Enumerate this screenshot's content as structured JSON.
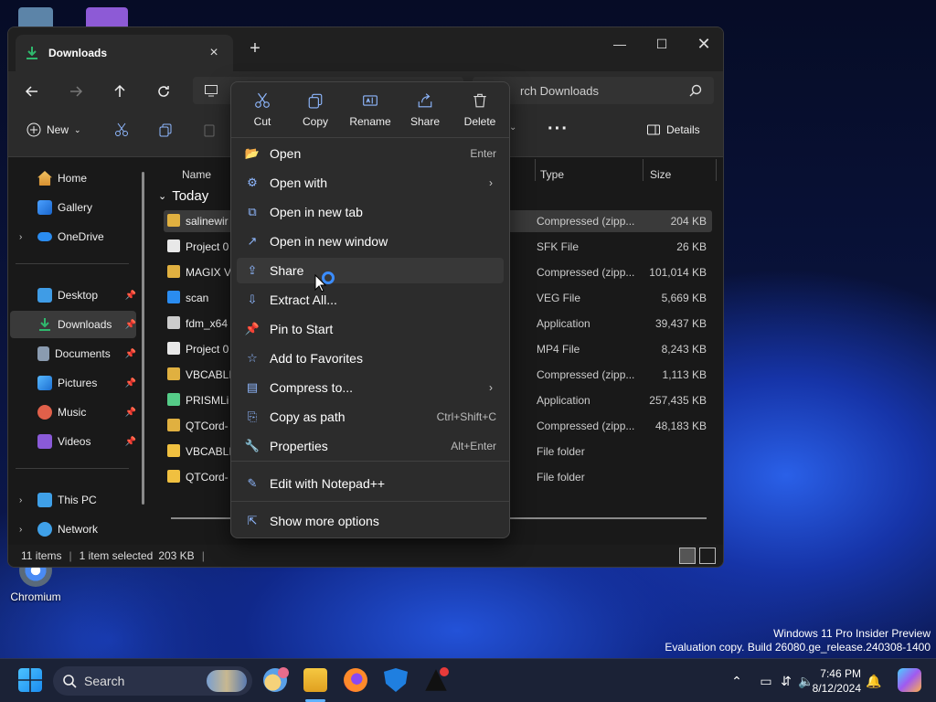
{
  "desktop": {
    "chromium_label": "Chromium",
    "watermark_line1": "Windows 11 Pro Insider Preview",
    "watermark_line2": "Evaluation copy. Build 26080.ge_release.240308-1400"
  },
  "window": {
    "tab_title": "Downloads",
    "search_placeholder": "rch Downloads",
    "toolbar": {
      "new_label": "New",
      "details_label": "Details"
    },
    "sidebar": [
      {
        "label": "Home",
        "icon": "home-icon"
      },
      {
        "label": "Gallery",
        "icon": "gallery-icon"
      },
      {
        "label": "OneDrive",
        "icon": "cloud-icon"
      },
      {
        "label": "Desktop",
        "icon": "desktop-icon"
      },
      {
        "label": "Downloads",
        "icon": "download-icon"
      },
      {
        "label": "Documents",
        "icon": "documents-icon"
      },
      {
        "label": "Pictures",
        "icon": "pictures-icon"
      },
      {
        "label": "Music",
        "icon": "music-icon"
      },
      {
        "label": "Videos",
        "icon": "videos-icon"
      },
      {
        "label": "This PC",
        "icon": "pc-icon"
      },
      {
        "label": "Network",
        "icon": "network-icon"
      }
    ],
    "columns": {
      "name": "Name",
      "type": "Type",
      "size": "Size"
    },
    "group": "Today",
    "files": [
      {
        "name": "salinewir",
        "type": "Compressed (zipp...",
        "size": "204 KB"
      },
      {
        "name": "Project 0",
        "type": "SFK File",
        "size": "26 KB"
      },
      {
        "name": "MAGIX V",
        "type": "Compressed (zipp...",
        "size": "101,014 KB"
      },
      {
        "name": "scan",
        "type": "VEG File",
        "size": "5,669 KB"
      },
      {
        "name": "fdm_x64",
        "type": "Application",
        "size": "39,437 KB"
      },
      {
        "name": "Project 0",
        "type": "MP4 File",
        "size": "8,243 KB"
      },
      {
        "name": "VBCABLI",
        "type": "Compressed (zipp...",
        "size": "1,113 KB"
      },
      {
        "name": "PRISMLi",
        "type": "Application",
        "size": "257,435 KB"
      },
      {
        "name": "QTCord-",
        "type": "Compressed (zipp...",
        "size": "48,183 KB"
      },
      {
        "name": "VBCABLI",
        "type": "File folder",
        "size": ""
      },
      {
        "name": "QTCord-",
        "type": "File folder",
        "size": ""
      }
    ],
    "status": {
      "count": "11 items",
      "selected": "1 item selected",
      "size": "203 KB"
    }
  },
  "context_menu": {
    "quick_actions": [
      "Cut",
      "Copy",
      "Rename",
      "Share",
      "Delete"
    ],
    "items": [
      {
        "label": "Open",
        "shortcut": "Enter"
      },
      {
        "label": "Open with",
        "shortcut": ""
      },
      {
        "label": "Open in new tab",
        "shortcut": ""
      },
      {
        "label": "Open in new window",
        "shortcut": ""
      },
      {
        "label": "Share",
        "shortcut": ""
      },
      {
        "label": "Extract All...",
        "shortcut": ""
      },
      {
        "label": "Pin to Start",
        "shortcut": ""
      },
      {
        "label": "Add to Favorites",
        "shortcut": ""
      },
      {
        "label": "Compress to...",
        "shortcut": ""
      },
      {
        "label": "Copy as path",
        "shortcut": "Ctrl+Shift+C"
      },
      {
        "label": "Properties",
        "shortcut": "Alt+Enter"
      },
      {
        "label": "Edit with Notepad++",
        "shortcut": ""
      },
      {
        "label": "Show more options",
        "shortcut": ""
      }
    ]
  },
  "taskbar": {
    "search_label": "Search",
    "time": "7:46 PM",
    "date": "8/12/2024"
  }
}
